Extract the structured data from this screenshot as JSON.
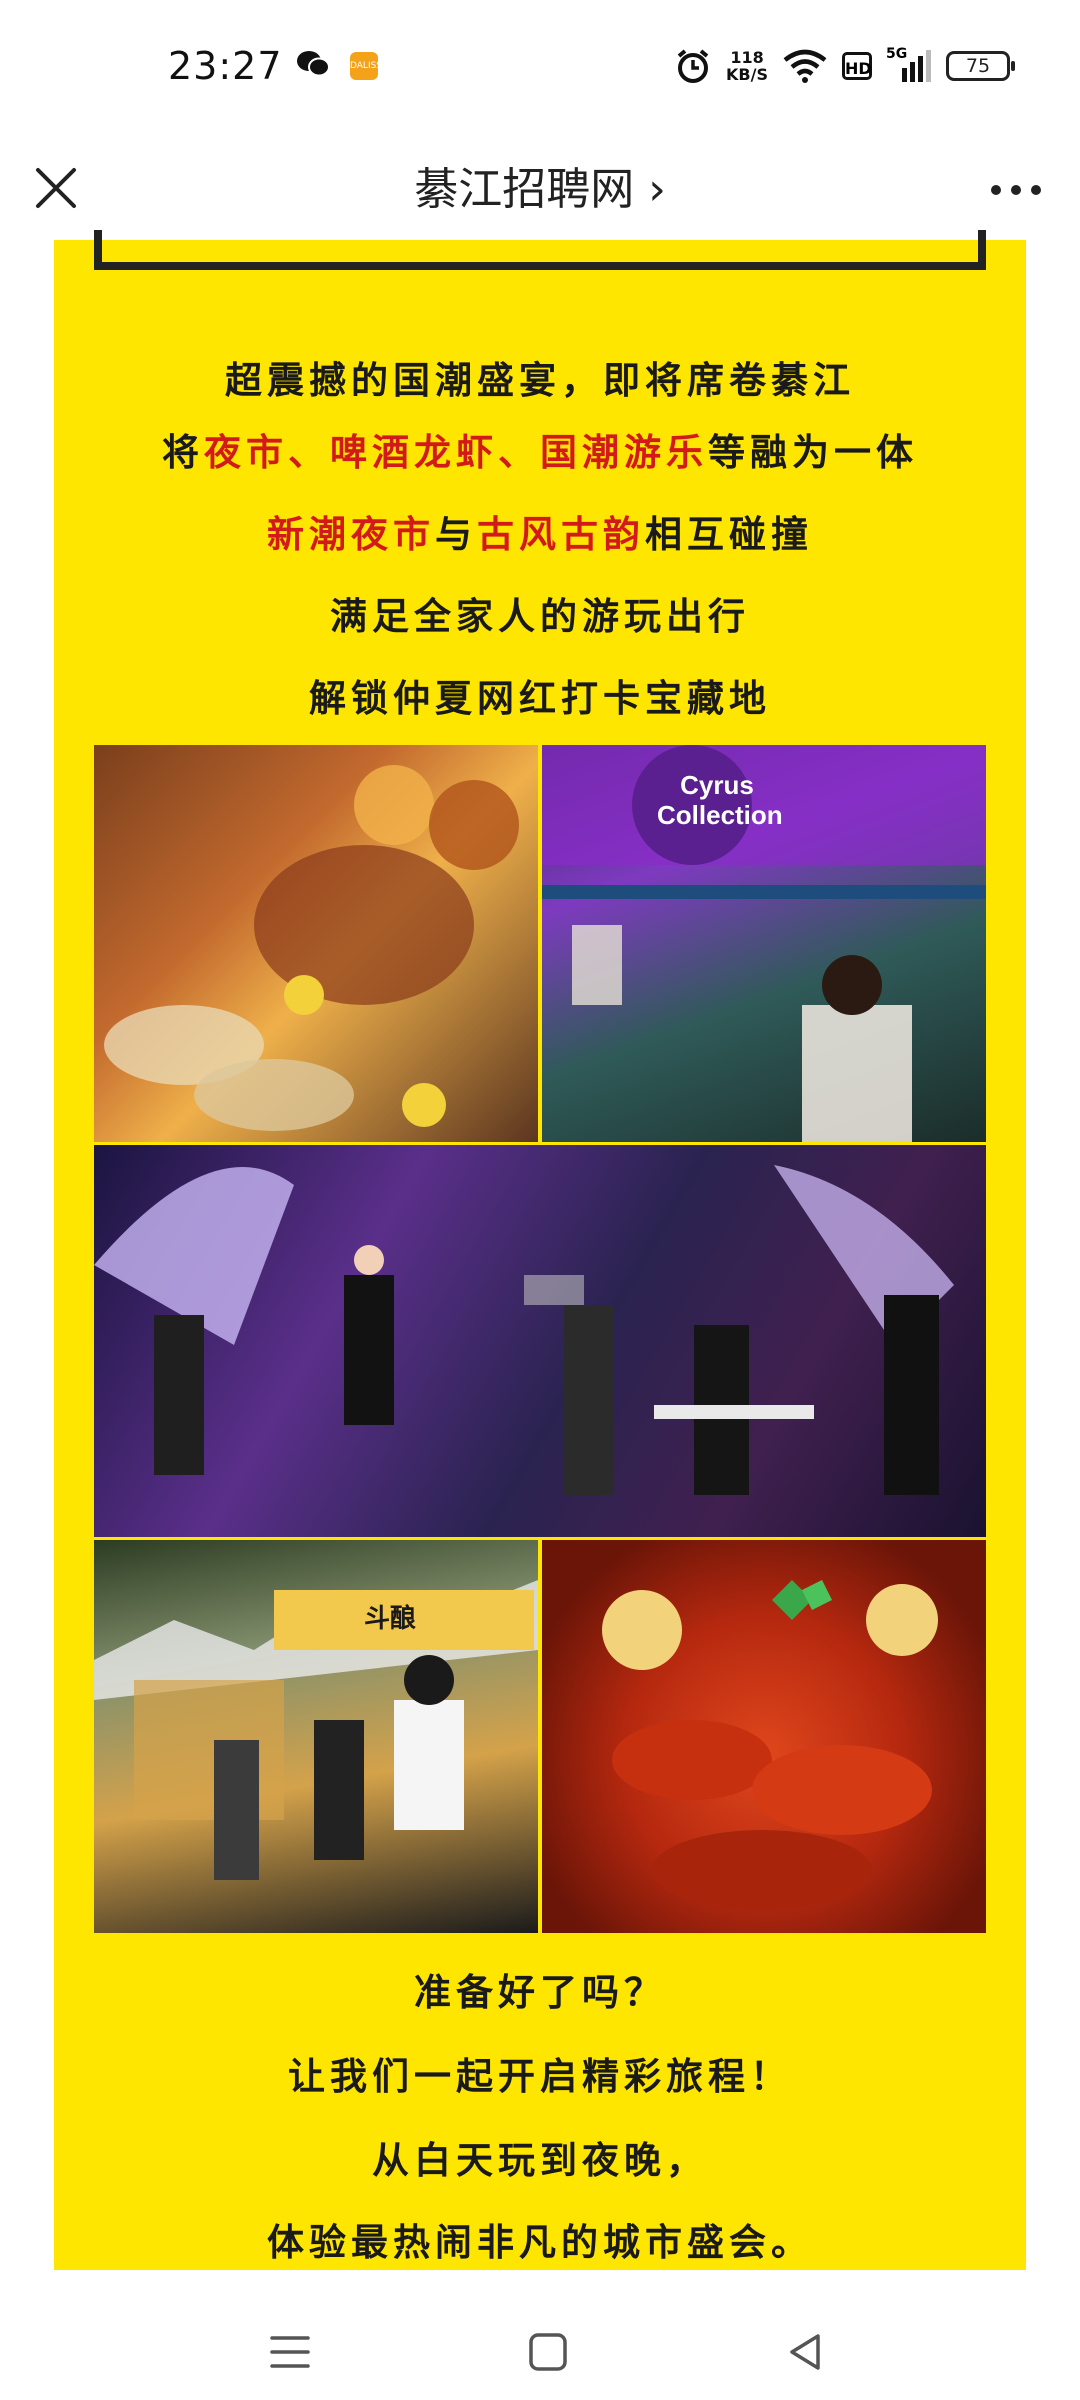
{
  "status_bar": {
    "time": "23:27",
    "app_icon_text": "DALISS",
    "speed_value": "118",
    "speed_unit": "KB/S",
    "hd_label": "HD",
    "network_label": "5G",
    "battery": "75",
    "icons": [
      "wechat-icon",
      "alarm-icon",
      "wifi-icon",
      "signal-icon",
      "battery-icon"
    ]
  },
  "title_bar": {
    "title": "綦江招聘网 ›",
    "icons": [
      "close-icon",
      "more-icon"
    ]
  },
  "poster": {
    "bg_color": "#ffe600",
    "highlight_color": "#d31a1a",
    "line1": "超震撼的国潮盛宴，即将席卷綦江",
    "line2": {
      "a": "将",
      "b": "夜市、啤酒龙虾、国潮游乐",
      "c": "等融为一体"
    },
    "line3": {
      "a": "新潮夜市",
      "b": "与",
      "c": "古风古韵",
      "d": "相互碰撞"
    },
    "line4": "满足全家人的游玩出行",
    "line5": "解锁仲夏网红打卡宝藏地",
    "photos": {
      "p1": "bbq-oysters-photo",
      "p2": "bar-stall-photo",
      "p3": "live-band-photo",
      "p4": "night-market-stalls-photo",
      "p5": "crayfish-photo",
      "stall_sign": "Cyrus Collection",
      "stall_sign_2": "斗酿"
    },
    "line6": "准备好了吗？",
    "line7": "让我们一起开启精彩旅程！",
    "line8": "从白天玩到夜晚，",
    "line9": "体验最热闹非凡的城市盛会。"
  },
  "nav_bar": {
    "icons": [
      "menu-icon",
      "home-icon",
      "back-icon"
    ]
  }
}
